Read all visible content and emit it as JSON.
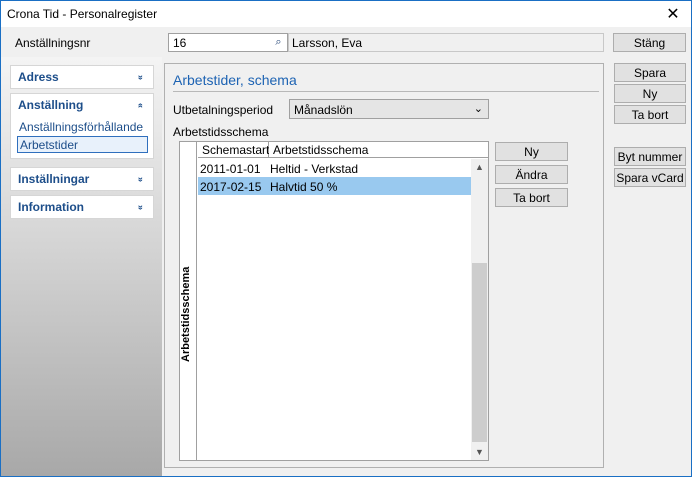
{
  "window": {
    "title": "Crona Tid - Personalregister",
    "close_glyph": "✕"
  },
  "header": {
    "employee_no_label": "Anställningsnr",
    "employee_no_value": "16",
    "employee_name": "Larsson, Eva",
    "close_button": "Stäng"
  },
  "right_buttons": {
    "save": "Spara",
    "new": "Ny",
    "delete": "Ta bort",
    "change_number": "Byt nummer",
    "save_vcard": "Spara vCard"
  },
  "sidebar": {
    "groups": [
      {
        "label": "Adress",
        "expanded": false,
        "chevron": "»"
      },
      {
        "label": "Anställning",
        "expanded": true,
        "chevron": "«",
        "items": [
          {
            "label": "Anställningsförhållande",
            "selected": false
          },
          {
            "label": "Arbetstider",
            "selected": true
          }
        ]
      },
      {
        "label": "Inställningar",
        "expanded": false,
        "chevron": "»"
      },
      {
        "label": "Information",
        "expanded": false,
        "chevron": "»"
      }
    ]
  },
  "main": {
    "section_title": "Arbetstider, schema",
    "pay_period_label": "Utbetalningsperiod",
    "pay_period_value": "Månadslön",
    "schedule_label": "Arbetstidsschema",
    "grid": {
      "vertical_tab": "Arbetstidsschema",
      "columns": [
        "Schemastart",
        "Arbetstidsschema"
      ],
      "rows": [
        {
          "start": "2011-01-01",
          "schedule": "Heltid - Verkstad",
          "selected": false
        },
        {
          "start": "2017-02-15",
          "schedule": "Halvtid 50 %",
          "selected": true
        }
      ]
    },
    "grid_buttons": {
      "new": "Ny",
      "edit": "Ändra",
      "delete": "Ta bort"
    }
  },
  "colors": {
    "accent": "#1d63b3",
    "selection": "#99c9ef",
    "window_border": "#1a6fc4"
  }
}
